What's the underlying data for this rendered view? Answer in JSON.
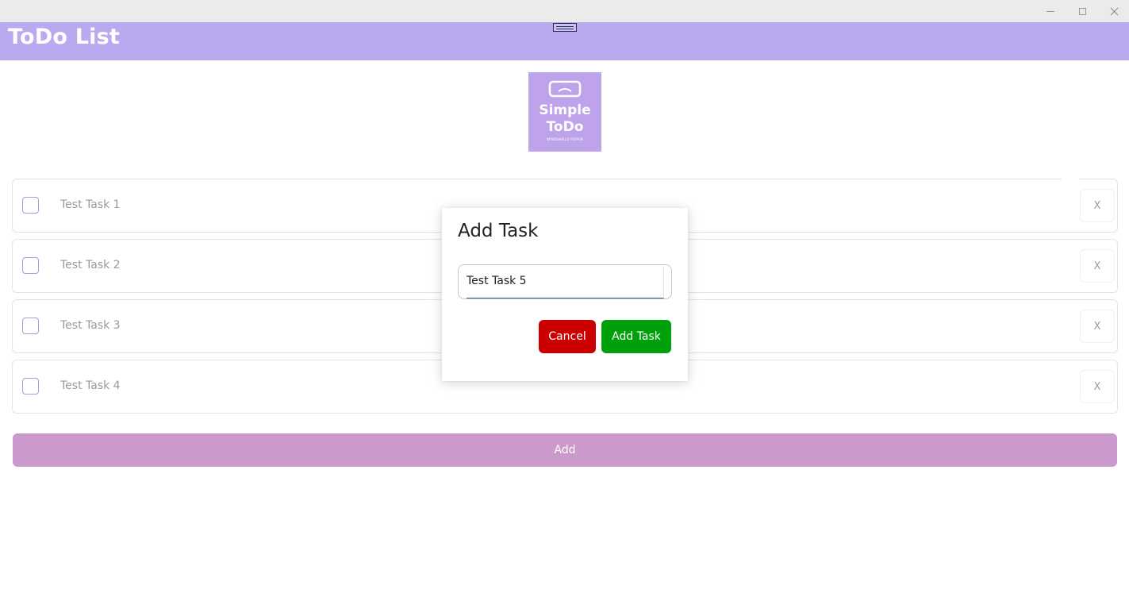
{
  "window": {
    "minimize_icon": "minimize-icon",
    "maximize_icon": "maximize-icon",
    "close_icon": "close-icon"
  },
  "header": {
    "title": "ToDo List",
    "background": "#b9a9ef"
  },
  "logo": {
    "line1": "Simple",
    "line2": "ToDo",
    "tagline": "WINDSHIELD REPAIR",
    "background": "#bfa3ea"
  },
  "tasks": [
    {
      "label": "Test Task 1",
      "checked": false,
      "delete_label": "X"
    },
    {
      "label": "Test Task 2",
      "checked": false,
      "delete_label": "X"
    },
    {
      "label": "Test Task 3",
      "checked": false,
      "delete_label": "X"
    },
    {
      "label": "Test Task 4",
      "checked": false,
      "delete_label": "X"
    }
  ],
  "add_button": {
    "label": "Add",
    "color": "#cc99cc"
  },
  "dialog": {
    "title": "Add Task",
    "input_value": "Test Task 5",
    "cancel_label": "Cancel",
    "cancel_color": "#cc0000",
    "confirm_label": "Add Task",
    "confirm_color": "#00a00a"
  }
}
